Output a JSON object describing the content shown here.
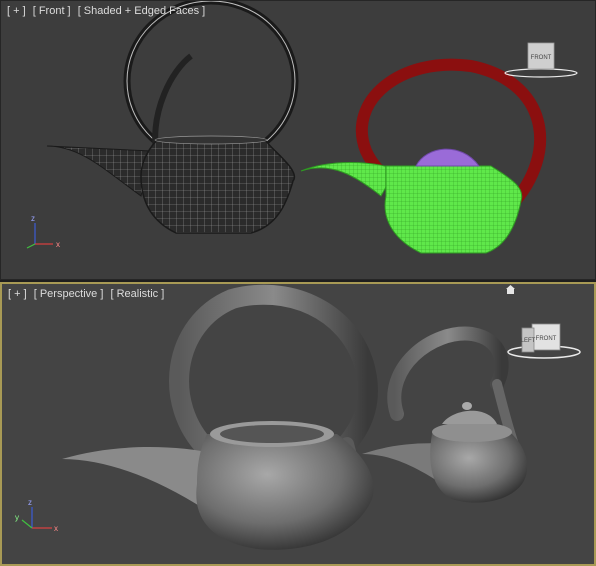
{
  "viewports": {
    "front": {
      "menu_plus": "[ + ]",
      "view_label": "[ Front ]",
      "shading_label": "[ Shaded + Edged Faces ]",
      "viewcube_face": "FRONT"
    },
    "perspective": {
      "menu_plus": "[ + ]",
      "view_label": "[ Perspective ]",
      "shading_label": "[ Realistic ]",
      "viewcube_front": "FRONT",
      "viewcube_left": "LEFT"
    }
  },
  "axis_labels": {
    "x": "x",
    "y": "y",
    "z": "z"
  },
  "colors": {
    "active_viewport_border": "#a89a55",
    "selected_object": "#5fe84a",
    "handle": "#8b0f0f",
    "lid": "#9a6bd8"
  }
}
